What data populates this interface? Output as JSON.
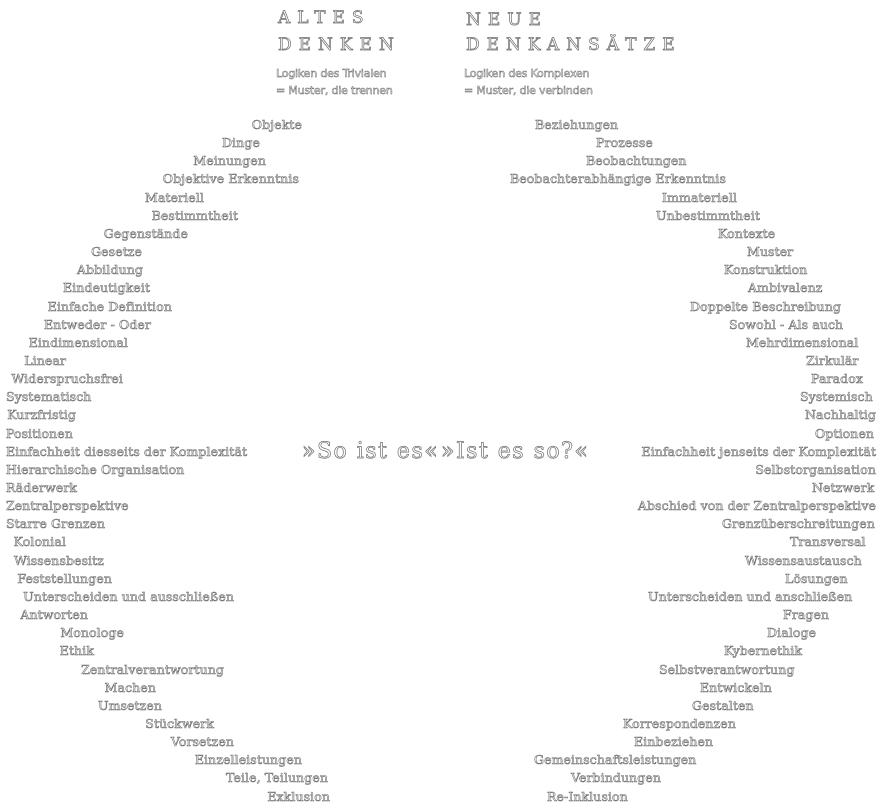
{
  "old_thinking": {
    "title_line1": "ALTES",
    "title_line2": "DENKEN",
    "subtitle_line1": "Logiken des Trivialen",
    "subtitle_line2": "= Muster, die trennen",
    "terms": [
      "Objekte",
      "Dinge",
      "Meinungen",
      "Objektive Erkenntnis",
      "Materiell",
      "Bestimmtheit",
      "Gegenstände",
      "Gesetze",
      "Abbildung",
      "Eindeutigkeit",
      "Einfache Definition",
      "Entweder - Oder",
      "Eindimensional",
      "Linear",
      "Widerspruchsfrei",
      "Systematisch",
      "Kurzfristig",
      "Positionen",
      "Einfachheit diesseits der Komplexität",
      "Hierarchische Organisation",
      "Räderwerk",
      "Zentralperspektive",
      "Starre Grenzen",
      "Kolonial",
      "Wissensbesitz",
      "Feststellungen",
      "Unterscheiden und ausschließen",
      "Antworten",
      "Monologe",
      "Ethik",
      "Zentralverantwortung",
      "Machen",
      "Umsetzen",
      "Stückwerk",
      "Vorsetzen",
      "Einzelleistungen",
      "Teile, Teilungen",
      "Exklusion"
    ]
  },
  "new_thinking": {
    "title_line1": "NEUE",
    "title_line2": "DENKANSÄTZE",
    "subtitle_line1": "Logiken des Komplexen",
    "subtitle_line2": "= Muster, die verbinden",
    "terms": [
      "Beziehungen",
      "Prozesse",
      "Beobachtungen",
      "Beobachterabhängige Erkenntnis",
      "Immateriell",
      "Unbestimmtheit",
      "Kontexte",
      "Muster",
      "Konstruktion",
      "Ambivalenz",
      "Doppelte Beschreibung",
      "Sowohl - Als auch",
      "Mehrdimensional",
      "Zirkulär",
      "Paradox",
      "Systemisch",
      "Nachhaltig",
      "Optionen",
      "Einfachheit jenseits der Komplexität",
      "Selbstorganisation",
      "Netzwerk",
      "Abschied von der Zentralperspektive",
      "Grenzüberschreitungen",
      "Transversal",
      "Wissensaustausch",
      "Lösungen",
      "Unterscheiden und anschließen",
      "Fragen",
      "Dialoge",
      "Kybernethik",
      "Selbstverantwortung",
      "Entwickeln",
      "Gestalten",
      "Korrespondenzen",
      "Einbeziehen",
      "Gemeinschaftsleistungen",
      "Verbindungen",
      "Re-Inklusion"
    ]
  },
  "center": {
    "old_quote": "»So ist es«",
    "new_quote": "»Ist es so?«"
  }
}
